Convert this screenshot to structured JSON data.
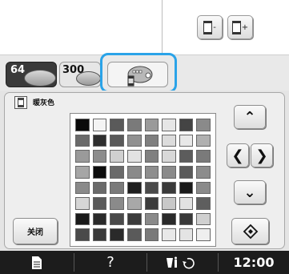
{
  "top": {
    "thread_minus_label": "-",
    "thread_plus_label": "+"
  },
  "tabs": [
    {
      "label": "64",
      "selected": true
    },
    {
      "label": "300",
      "selected": false
    },
    {
      "label": "",
      "icon": "custom-thread-icon",
      "selected": false,
      "highlighted": true
    }
  ],
  "palette": {
    "selected_color_name": "暖灰色",
    "rows": [
      [
        "#0a0a0a",
        "#f4f4f4",
        "#5a5a5a",
        "#7a7a7a",
        "#9a9a9a",
        "#e6e6e6",
        "#444444",
        "#8a8a8a"
      ],
      [
        "#6a6a6a",
        "#2e2e2e",
        "#595959",
        "#909090",
        "#7f7f7f",
        "#dcdcdc",
        "#e8e8e8",
        "#b0b0b0"
      ],
      [
        "#9a9a9a",
        "#8c8c8c",
        "#d0d0d0",
        "#e2e2e2",
        "#808080",
        "#d8d8d8",
        "#5c5c5c",
        "#7a7a7a"
      ],
      [
        "#a6a6a6",
        "#0c0c0c",
        "#6a6a6a",
        "#8a8a8a",
        "#8e8e8e",
        "#8a8a8a",
        "#5a5a5a",
        "#8c8c8c"
      ],
      [
        "#8a8a8a",
        "#6a6a6a",
        "#7a7a7a",
        "#1e1e1e",
        "#4a4a4a",
        "#3a3a3a",
        "#1a1a1a",
        "#8a8a8a"
      ],
      [
        "#d6d6d6",
        "#5a5a5a",
        "#8a8a8a",
        "#a8a8a8",
        "#3c3c3c",
        "#c8c8c8",
        "#e2e2e2",
        "#5e5e5e"
      ],
      [
        "#1a1a1a",
        "#2a2a2a",
        "#4a4a4a",
        "#3c3c3c",
        "#8a8a8a",
        "#2a2a2a",
        "#3a3a3a",
        "#d0d0d0"
      ],
      [
        "#4a4a4a",
        "#3a3a3a",
        "#2a2a2a",
        "#5a5a5a",
        "#7a7a7a",
        "#e8e8e8",
        "#e4e4e4",
        "#efefef"
      ]
    ]
  },
  "buttons": {
    "close_label": "关闭"
  },
  "status_bar": {
    "help_label": "?",
    "clock": "12:00"
  },
  "colors": {
    "highlight": "#2aa3e8",
    "status_bar_bg": "#1c1c1c",
    "tab_selected_bg": "#3a3a3a"
  }
}
